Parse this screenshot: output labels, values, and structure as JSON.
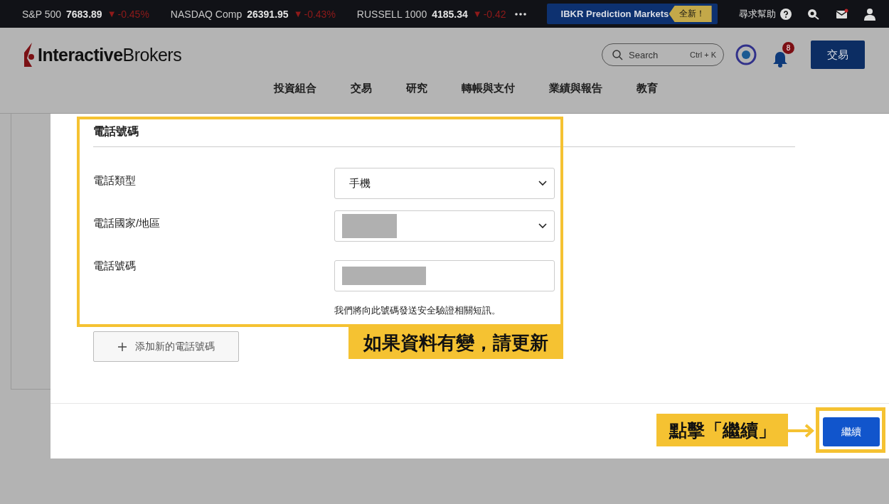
{
  "ticker": [
    {
      "name": "S&P 500",
      "value": "7683.89",
      "arrow": "▼",
      "change": "-0.45%"
    },
    {
      "name": "NASDAQ Comp",
      "value": "26391.95",
      "arrow": "▼",
      "change": "-0.43%"
    },
    {
      "name": "RUSSELL 1000",
      "value": "4185.34",
      "arrow": "▼",
      "change": "-0.42"
    }
  ],
  "promo": {
    "label": "IBKR Prediction Markets",
    "badge": "全新！"
  },
  "help": {
    "label": "尋求幫助"
  },
  "header": {
    "logo": "**Interactive**Brokers",
    "search": {
      "placeholder": "Search",
      "shortcut": "Ctrl + K"
    },
    "notification_count": "8",
    "trade_button": "交易"
  },
  "nav": [
    "投資組合",
    "交易",
    "研究",
    "轉帳與支付",
    "業績與報告",
    "教育"
  ],
  "modal": {
    "section_title": "電話號碼",
    "fields": [
      {
        "label": "電話類型",
        "kind": "select",
        "value": "手機",
        "redacted": false
      },
      {
        "label": "電話國家/地區",
        "kind": "select",
        "redacted": true
      },
      {
        "label": "電話號碼",
        "kind": "input",
        "redacted": true,
        "hint": "我們將向此號碼發送安全驗證相關短訊。"
      }
    ],
    "add_button": "添加新的電話號碼",
    "continue_button": "繼續"
  },
  "annotations": [
    {
      "kind": "box",
      "text": "如果資料有變，請更新"
    },
    {
      "kind": "arrow",
      "text": "點擊「繼續」"
    }
  ]
}
